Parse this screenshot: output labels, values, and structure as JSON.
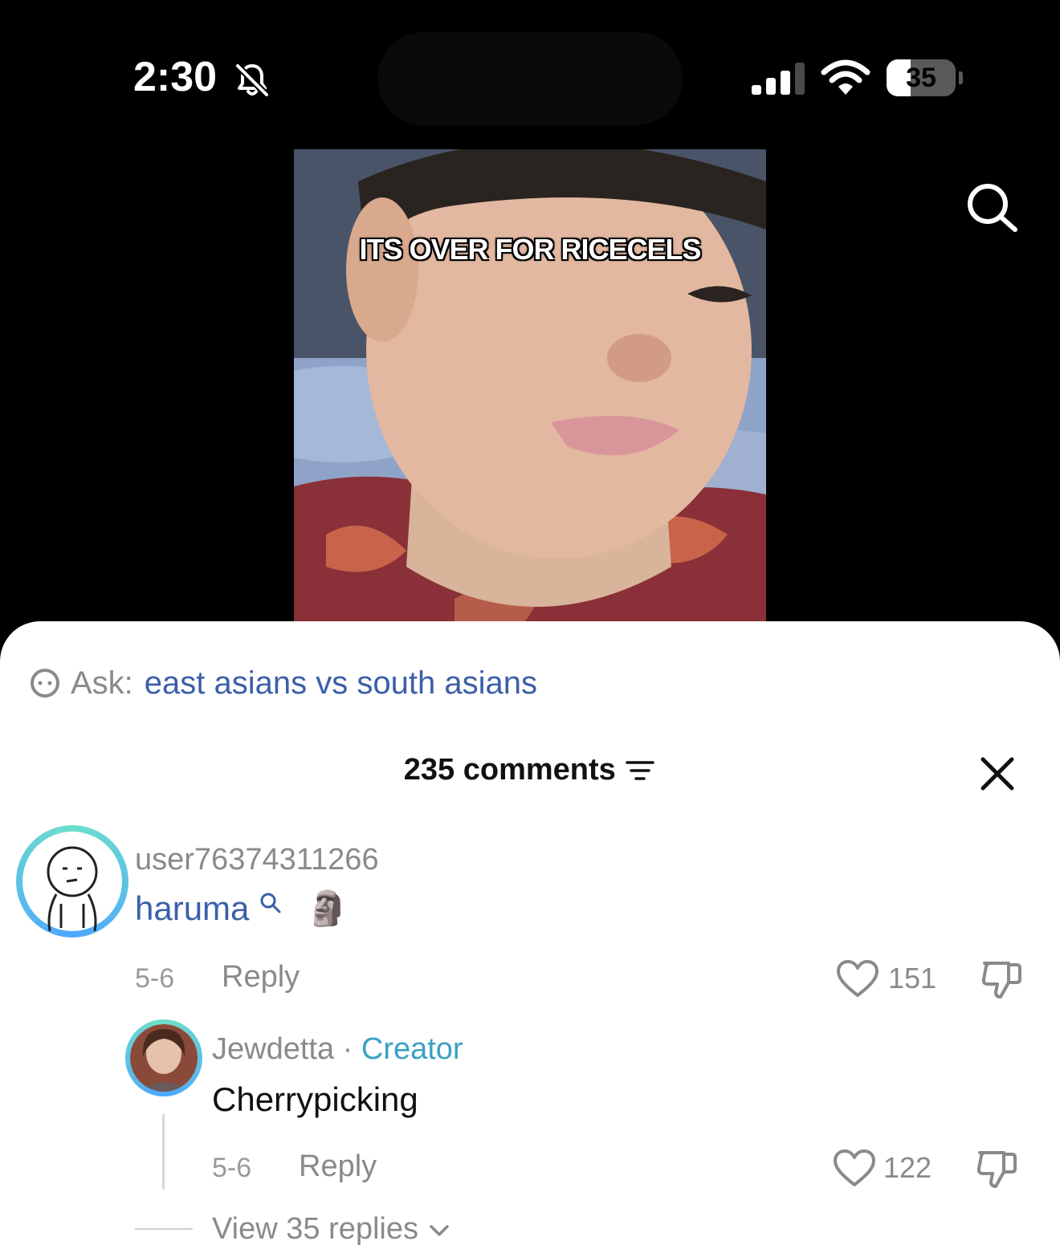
{
  "status_bar": {
    "time": "2:30",
    "battery_percent": "35",
    "battery_level": 0.35
  },
  "video": {
    "caption": "ITS OVER FOR RICECELS"
  },
  "ask": {
    "label": "Ask:",
    "query": "east asians vs south asians"
  },
  "comments_header": {
    "count_label": "235 comments"
  },
  "comments": [
    {
      "username": "user76374311266",
      "mention": "haruma",
      "emoji": "🗿",
      "date": "5-6",
      "reply_label": "Reply",
      "likes": "151"
    },
    {
      "username": "Jewdetta",
      "separator": "·",
      "badge": "Creator",
      "text": "Cherrypicking",
      "date": "5-6",
      "reply_label": "Reply",
      "likes": "122"
    }
  ],
  "view_replies_label": "View 35 replies",
  "icons": {
    "bell": "bell-slash-icon",
    "signal": "cellular-signal-icon",
    "wifi": "wifi-icon",
    "battery": "battery-icon",
    "search": "search-icon",
    "ask": "chat-bubble-icon",
    "filter": "filter-icon",
    "close": "close-icon",
    "like": "heart-icon",
    "dislike": "thumbs-down-icon",
    "chevron": "chevron-down-icon"
  },
  "colors": {
    "link": "#3b5fa8",
    "creator": "#3aa0c8",
    "muted": "#8a8a8a"
  }
}
